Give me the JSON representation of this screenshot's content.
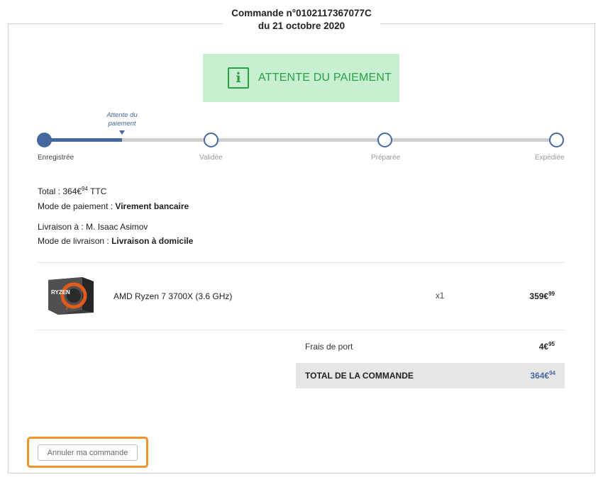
{
  "order": {
    "title": "Commande n°0102117367077C",
    "date": "du 21 octobre 2020"
  },
  "status": {
    "icon": "info-icon",
    "icon_glyph": "i",
    "label": "ATTENTE DU PAIEMENT",
    "color": "#2aa144",
    "background": "#c9efd2"
  },
  "progress": {
    "current_label_line1": "Attente du",
    "current_label_line2": "paiement",
    "fill_fraction": 0.15,
    "steps": [
      {
        "label": "Enregistrée",
        "done": true
      },
      {
        "label": "Validée",
        "done": false
      },
      {
        "label": "Préparée",
        "done": false
      },
      {
        "label": "Expédiée",
        "done": false
      }
    ],
    "accent": "#45689e"
  },
  "summary": {
    "total_prefix": "Total : 364€",
    "total_cents": "94",
    "total_suffix": " TTC",
    "payment_label": "Mode de paiement : ",
    "payment_value": "Virement bancaire",
    "delivery_to_label": "Livraison à : ",
    "delivery_to_value": "M. Isaac Asimov",
    "delivery_mode_label": "Mode de livraison : ",
    "delivery_mode_value": "Livraison à domicile"
  },
  "items": [
    {
      "image": "ryzen-box-image",
      "image_text": "RYZEN",
      "name": "AMD Ryzen 7 3700X (3.6 GHz)",
      "qty": "x1",
      "price_main": "359€",
      "price_cents": "99"
    }
  ],
  "totals": {
    "fees_label": "Frais de port",
    "fees_main": "4€",
    "fees_cents": "95",
    "total_label": "TOTAL DE LA COMMANDE",
    "total_main": "364€",
    "total_cents": "94"
  },
  "actions": {
    "cancel_label": "Annuler ma commande",
    "highlight_color": "#f0932b"
  }
}
